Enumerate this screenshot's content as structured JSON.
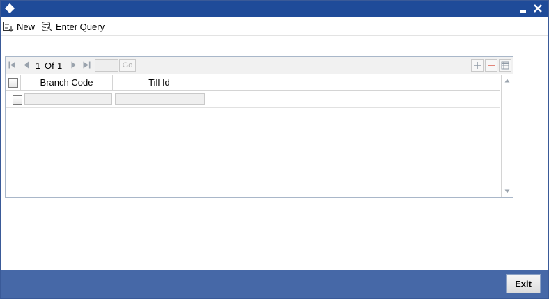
{
  "toolbar": {
    "new_label": "New",
    "enter_query_label": "Enter Query"
  },
  "pager": {
    "current_page": "1",
    "of_label": "Of",
    "total_pages": "1",
    "go_label": "Go",
    "page_input_value": ""
  },
  "grid": {
    "columns": [
      "Branch Code",
      "Till Id"
    ],
    "rows": [
      {
        "branch_code": "",
        "till_id": ""
      }
    ]
  },
  "footer": {
    "exit_label": "Exit"
  },
  "colors": {
    "titlebar": "#1f4b99",
    "footer": "#4668a7"
  },
  "icons": [
    "window-diamond-icon",
    "minimize-icon",
    "close-icon",
    "new-icon",
    "enter-query-icon",
    "first-page-icon",
    "prev-page-icon",
    "next-page-icon",
    "last-page-icon",
    "add-row-icon",
    "delete-row-icon",
    "single-view-icon",
    "scroll-up-icon",
    "scroll-down-icon"
  ]
}
